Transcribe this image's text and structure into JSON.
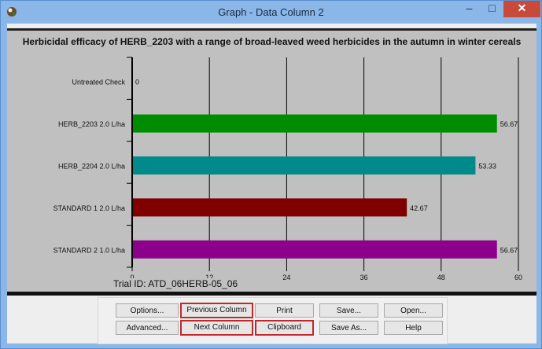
{
  "window": {
    "title": "Graph - Data Column 2",
    "minimize_glyph": "–",
    "maximize_glyph": "□",
    "close_glyph": "✕"
  },
  "chart_data": {
    "type": "bar",
    "orientation": "horizontal",
    "title": "Herbicidal efficacy of HERB_2203 with a range of broad-leaved weed herbicides in the autumn in winter cereals",
    "categories": [
      "Untreated Check",
      "HERB_2203 2.0 L/ha",
      "HERB_2204 2.0 L/ha",
      "STANDARD 1 2.0 L/ha",
      "STANDARD 2 1.0 L/ha"
    ],
    "values": [
      0,
      56.67,
      53.33,
      42.67,
      56.67
    ],
    "value_labels": [
      "0",
      "56.67",
      "53.33",
      "42.67",
      "56.67"
    ],
    "colors": [
      "#000000",
      "#008c00",
      "#008a8a",
      "#800000",
      "#8c008c"
    ],
    "xlim": [
      0,
      60
    ],
    "xticks": [
      "0",
      "12",
      "24",
      "36",
      "48",
      "60"
    ],
    "grid": true,
    "background": "#c0c0c0",
    "footnote": "Trial ID: ATD_06HERB-05_06"
  },
  "buttons": {
    "options": "Options...",
    "previous_column": "Previous Column",
    "print": "Print",
    "save": "Save...",
    "open": "Open...",
    "advanced": "Advanced...",
    "next_column": "Next Column",
    "clipboard": "Clipboard",
    "save_as": "Save As...",
    "help": "Help"
  }
}
